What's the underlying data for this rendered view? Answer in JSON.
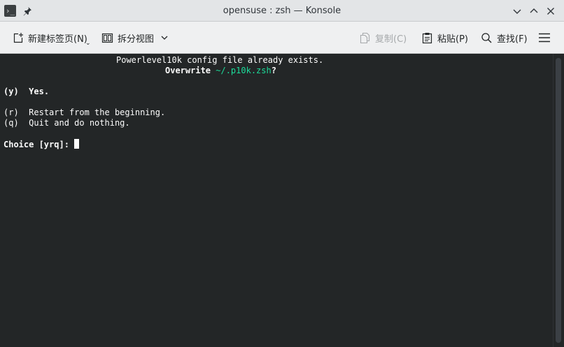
{
  "window": {
    "title": "opensuse : zsh — Konsole",
    "app_icon_glyph": "›_"
  },
  "toolbar": {
    "new_tab_label": "新建标签页(N)",
    "split_view_label": "拆分视图",
    "copy_label": "复制(C)",
    "paste_label": "粘贴(P)",
    "find_label": "查找(F)"
  },
  "terminal": {
    "line1": "Powerlevel10k config file already exists.",
    "line2_prefix": "Overwrite ",
    "line2_path": "~/.p10k.zsh",
    "line2_suffix": "?",
    "opt_y_key": "(y)",
    "opt_y_text": "Yes.",
    "opt_r_key": "(r)",
    "opt_r_text": "Restart from the beginning.",
    "opt_q_key": "(q)",
    "opt_q_text": "Quit and do nothing.",
    "prompt": "Choice [yrq]: "
  },
  "colors": {
    "terminal_bg": "#232627",
    "terminal_fg": "#fcfcfc",
    "path_green": "#1cdc9a",
    "titlebar_bg": "#e3e5e7",
    "toolbar_bg": "#eff0f1"
  },
  "icons": {
    "app": "terminal-icon",
    "pin": "pin-icon",
    "minimize": "chevron-down-icon",
    "maximize": "chevron-up-icon",
    "close": "close-icon",
    "new_tab": "new-tab-icon",
    "split_view": "split-view-icon",
    "copy": "copy-icon",
    "paste": "paste-icon",
    "find": "search-icon",
    "menu": "hamburger-menu-icon"
  }
}
